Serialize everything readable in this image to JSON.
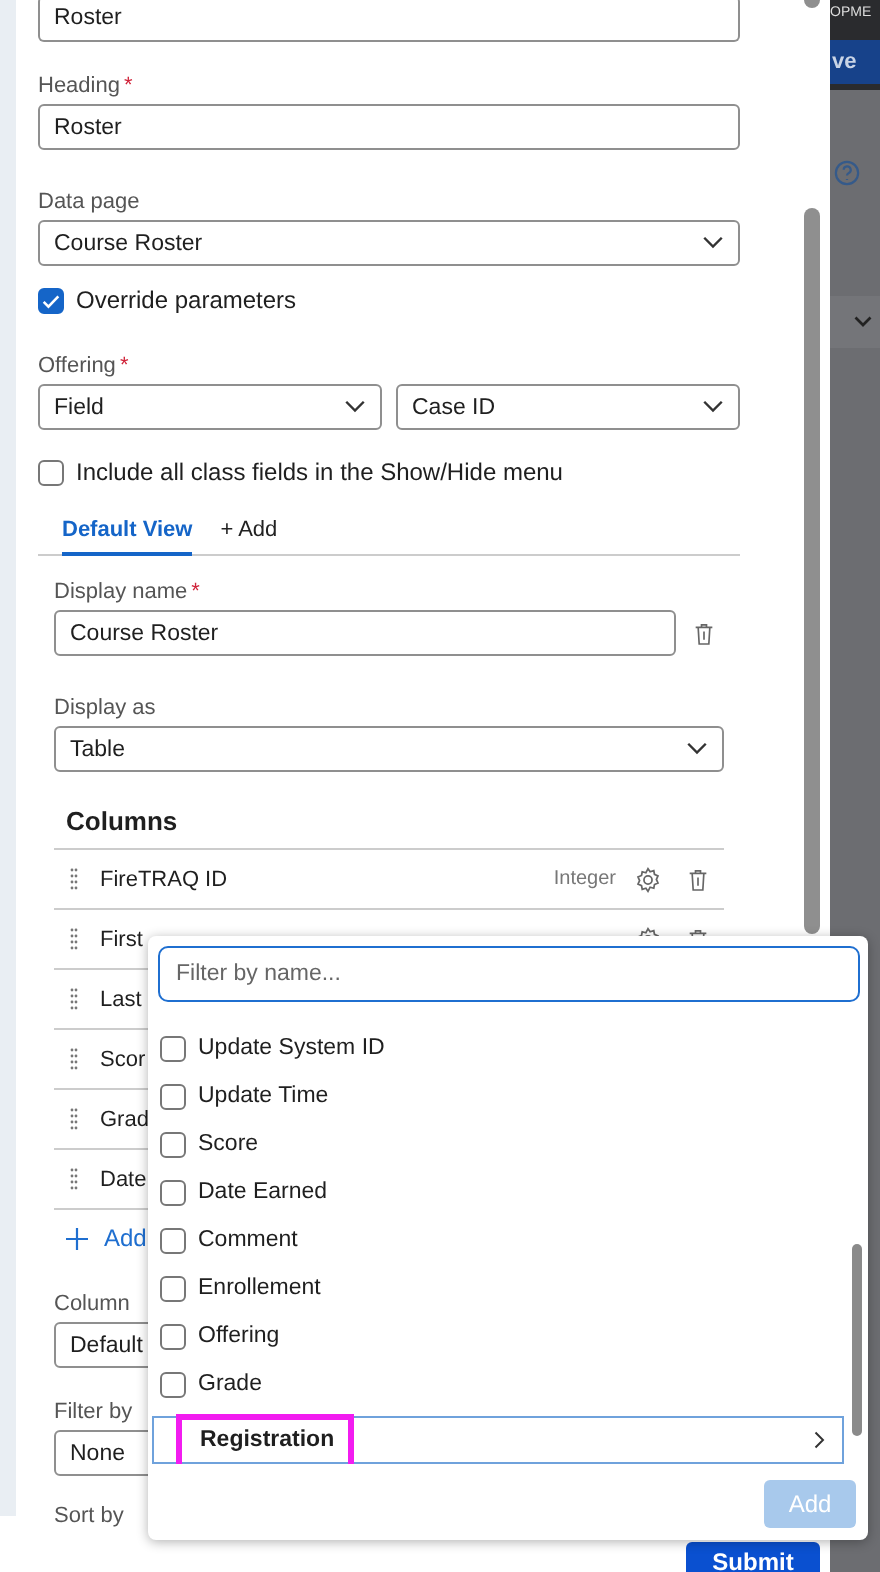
{
  "background": {
    "header_text": "OPME",
    "button": "ve"
  },
  "top_field": {
    "value": "Roster"
  },
  "heading": {
    "label": "Heading",
    "marker": "*",
    "value": "Roster"
  },
  "data_page": {
    "label": "Data page",
    "value": "Course Roster"
  },
  "override": {
    "label": "Override parameters",
    "checked": true
  },
  "offering": {
    "label": "Offering",
    "marker": "*",
    "source": "Field",
    "value": "Case ID"
  },
  "include_all": {
    "label": "Include all class fields in the Show/Hide menu",
    "checked": false
  },
  "tabs": [
    {
      "label": "Default View",
      "selected": true
    },
    {
      "label": "+ Add",
      "selected": false
    }
  ],
  "display_name": {
    "label": "Display name",
    "marker": "*",
    "value": "Course Roster"
  },
  "display_as": {
    "label": "Display as",
    "value": "Table"
  },
  "columns": {
    "heading": "Columns",
    "add_label": "Add",
    "rows": [
      {
        "name": "FireTRAQ ID",
        "type": "Integer",
        "actions": true
      },
      {
        "name": "First",
        "actions": true
      },
      {
        "name": "Last"
      },
      {
        "name": "Scor"
      },
      {
        "name": "Grad"
      },
      {
        "name": "Date"
      }
    ]
  },
  "column_to": {
    "label": "Column",
    "value": "Default"
  },
  "filter_by": {
    "label": "Filter by",
    "value": "None"
  },
  "sort_by": {
    "label": "Sort by"
  },
  "submit": "Submit",
  "picker": {
    "placeholder": "Filter by name...",
    "items": [
      {
        "kind": "checkbox",
        "label": "Update System ID",
        "checked": false
      },
      {
        "kind": "checkbox",
        "label": "Update Time",
        "checked": false
      },
      {
        "kind": "checkbox",
        "label": "Score",
        "checked": false
      },
      {
        "kind": "checkbox",
        "label": "Date Earned",
        "checked": false
      },
      {
        "kind": "checkbox",
        "label": "Comment",
        "checked": false
      },
      {
        "kind": "checkbox",
        "label": "Enrollement",
        "checked": false
      },
      {
        "kind": "checkbox",
        "label": "Offering",
        "checked": false
      },
      {
        "kind": "checkbox",
        "label": "Grade",
        "checked": false
      },
      {
        "kind": "group",
        "label": "Registration",
        "selected": true,
        "highlighted": true
      }
    ],
    "add": {
      "label": "Add",
      "disabled": true
    }
  }
}
